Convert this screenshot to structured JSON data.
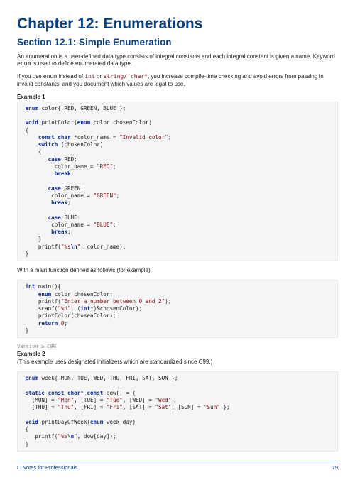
{
  "chapter_title": "Chapter 12: Enumerations",
  "section_title": "Section 12.1: Simple Enumeration",
  "para1_a": "An enumeration is a user-defined data type consists of integral constants and each integral constant is given a name. Keyword ",
  "para1_kw": "enum",
  "para1_b": " is used to define enumerated data type.",
  "para2_a": "If you use ",
  "para2_kw1": "enum",
  "para2_b": " instead of ",
  "para2_kw2": "int",
  "para2_c": " or ",
  "para2_kw3": "string",
  "para2_kw4": "/ ",
  "para2_kw5": "char*",
  "para2_d": ", you increase compile-time checking and avoid errors from passing in invalid constants, and you document which values are legal to use.",
  "example1_label": "Example 1",
  "between_text": "With a main function defined as follows (for example):",
  "version_note": "Version ≥ C99",
  "example2_label": "Example 2",
  "example2_intro": "(This example uses designated initializers which are standardized since C99.)",
  "footer_left": "C Notes for Professionals",
  "footer_right": "79"
}
